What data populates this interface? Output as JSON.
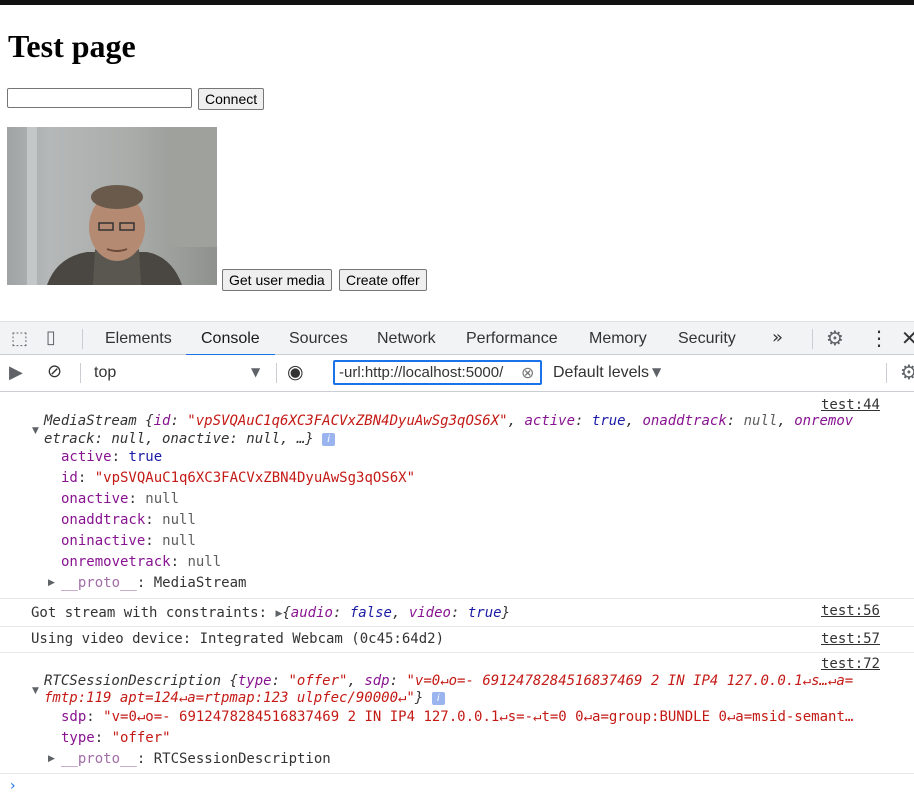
{
  "page": {
    "title": "Test page",
    "connect_label": "Connect",
    "connect_input_value": "",
    "get_media_label": "Get user media",
    "create_offer_label": "Create offer"
  },
  "devtools": {
    "tabs": [
      "Elements",
      "Console",
      "Sources",
      "Network",
      "Performance",
      "Memory",
      "Security"
    ],
    "active_tab": "Console",
    "more_tabs_icon": "»",
    "context": "top",
    "filter_value": "-url:http://localhost:5000/",
    "levels": "Default levels"
  },
  "console": {
    "entry1": {
      "source": "test:44",
      "summary_l1_prefix": "MediaStream {",
      "summary_l1_k_id": "id",
      "summary_l1_v_id": "\"vpSVQAuC1q6XC3FACVxZBN4DyuAwSg3qOS6X\"",
      "summary_l1_k_active": "active",
      "summary_l1_v_active": "true",
      "summary_l1_k_onaddtrack": "onaddtrack",
      "summary_l1_v_onaddtrack": "null",
      "summary_l1_tail": "onremov",
      "summary_l2": "etrack: null, onactive: null, …}",
      "props": [
        {
          "key": "active",
          "value": "true",
          "kind": "kw"
        },
        {
          "key": "id",
          "value": "\"vpSVQAuC1q6XC3FACVxZBN4DyuAwSg3qOS6X\"",
          "kind": "s"
        },
        {
          "key": "onactive",
          "value": "null",
          "kind": "nl"
        },
        {
          "key": "onaddtrack",
          "value": "null",
          "kind": "nl"
        },
        {
          "key": "oninactive",
          "value": "null",
          "kind": "nl"
        },
        {
          "key": "onremovetrack",
          "value": "null",
          "kind": "nl"
        }
      ],
      "proto_key": "__proto__",
      "proto_value": "MediaStream"
    },
    "entry2": {
      "source": "test:56",
      "text": "Got stream with constraints: ",
      "obj_open": "{",
      "k_audio": "audio",
      "v_audio": "false",
      "k_video": "video",
      "v_video": "true",
      "obj_close": "}"
    },
    "entry3": {
      "source": "test:57",
      "text": "Using video device: Integrated Webcam (0c45:64d2)"
    },
    "entry4": {
      "source": "test:72",
      "summary_l1_prefix": "RTCSessionDescription {",
      "k_type": "type",
      "v_type": "\"offer\"",
      "k_sdp": "sdp",
      "v_sdp_l1": "\"v=0↵o=- 6912478284516837469 2 IN IP4 127.0.0.1↵s…↵a=",
      "v_sdp_l2": "fmtp:119 apt=124↵a=rtpmap:123 ulpfec/90000↵\"",
      "summary_close": "}",
      "sdp_key": "sdp",
      "sdp_value": "\"v=0↵o=- 6912478284516837469 2 IN IP4 127.0.0.1↵s=-↵t=0 0↵a=group:BUNDLE 0↵a=msid-semant…",
      "type_key": "type",
      "type_value": "\"offer\"",
      "proto_key": "__proto__",
      "proto_value": "RTCSessionDescription"
    },
    "prompt": "›"
  },
  "icons": [
    "inspect-icon",
    "device-toggle-icon",
    "more-tabs-icon",
    "settings-icon",
    "kebab-menu-icon",
    "close-icon",
    "sidebar-toggle-icon",
    "clear-console-icon",
    "dropdown-icon",
    "eye-icon",
    "clear-filter-icon",
    "info-icon",
    "expand-triangle-icon"
  ],
  "colors": {
    "active_tab": "#1a73e8",
    "key": "#881391",
    "string": "#c41a16",
    "keyword": "#1a1aa6"
  }
}
